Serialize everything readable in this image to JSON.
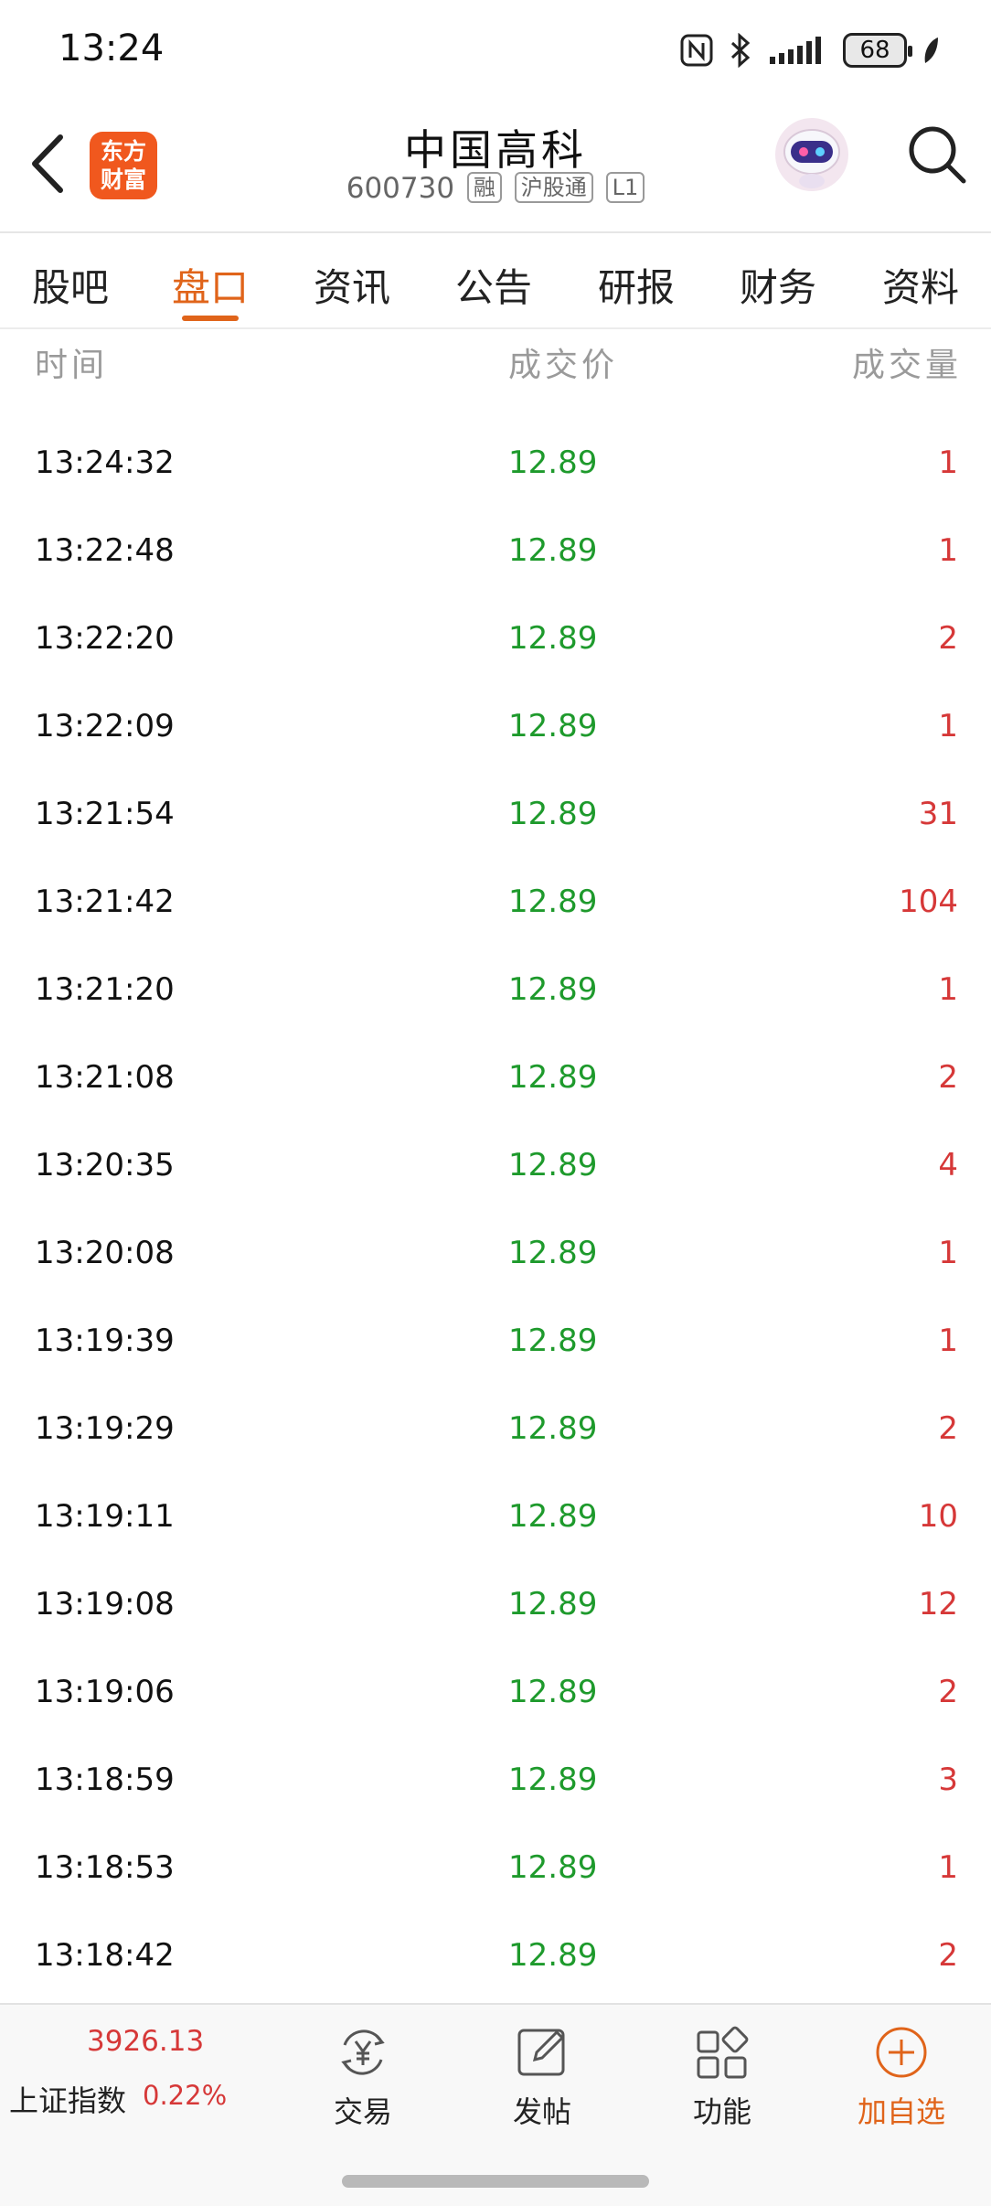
{
  "status_bar": {
    "time": "13:24",
    "battery": "68"
  },
  "header": {
    "logo_line1": "东方",
    "logo_line2": "财富",
    "stock_name": "中国高科",
    "stock_code": "600730",
    "tags": [
      "融",
      "沪股通",
      "L1"
    ]
  },
  "tabs": [
    {
      "label": "股吧",
      "active": false
    },
    {
      "label": "盘口",
      "active": true
    },
    {
      "label": "资讯",
      "active": false
    },
    {
      "label": "公告",
      "active": false
    },
    {
      "label": "研报",
      "active": false
    },
    {
      "label": "财务",
      "active": false
    },
    {
      "label": "资料",
      "active": false
    }
  ],
  "table": {
    "headers": {
      "time": "时间",
      "price": "成交价",
      "volume": "成交量"
    },
    "rows": [
      {
        "time": "13:24:32",
        "price": "12.89",
        "volume": "1"
      },
      {
        "time": "13:22:48",
        "price": "12.89",
        "volume": "1"
      },
      {
        "time": "13:22:20",
        "price": "12.89",
        "volume": "2"
      },
      {
        "time": "13:22:09",
        "price": "12.89",
        "volume": "1"
      },
      {
        "time": "13:21:54",
        "price": "12.89",
        "volume": "31"
      },
      {
        "time": "13:21:42",
        "price": "12.89",
        "volume": "104"
      },
      {
        "time": "13:21:20",
        "price": "12.89",
        "volume": "1"
      },
      {
        "time": "13:21:08",
        "price": "12.89",
        "volume": "2"
      },
      {
        "time": "13:20:35",
        "price": "12.89",
        "volume": "4"
      },
      {
        "time": "13:20:08",
        "price": "12.89",
        "volume": "1"
      },
      {
        "time": "13:19:39",
        "price": "12.89",
        "volume": "1"
      },
      {
        "time": "13:19:29",
        "price": "12.89",
        "volume": "2"
      },
      {
        "time": "13:19:11",
        "price": "12.89",
        "volume": "10"
      },
      {
        "time": "13:19:08",
        "price": "12.89",
        "volume": "12"
      },
      {
        "time": "13:19:06",
        "price": "12.89",
        "volume": "2"
      },
      {
        "time": "13:18:59",
        "price": "12.89",
        "volume": "3"
      },
      {
        "time": "13:18:53",
        "price": "12.89",
        "volume": "1"
      },
      {
        "time": "13:18:42",
        "price": "12.89",
        "volume": "2"
      }
    ]
  },
  "bottom_bar": {
    "index_value": "3926.13",
    "index_name": "上证指数",
    "index_change": "0.22%",
    "trade_label": "交易",
    "post_label": "发帖",
    "function_label": "功能",
    "add_watch_label": "加自选"
  },
  "colors": {
    "accent": "#e0641a",
    "price_green": "#1e9a2c",
    "volume_red": "#d63838"
  }
}
